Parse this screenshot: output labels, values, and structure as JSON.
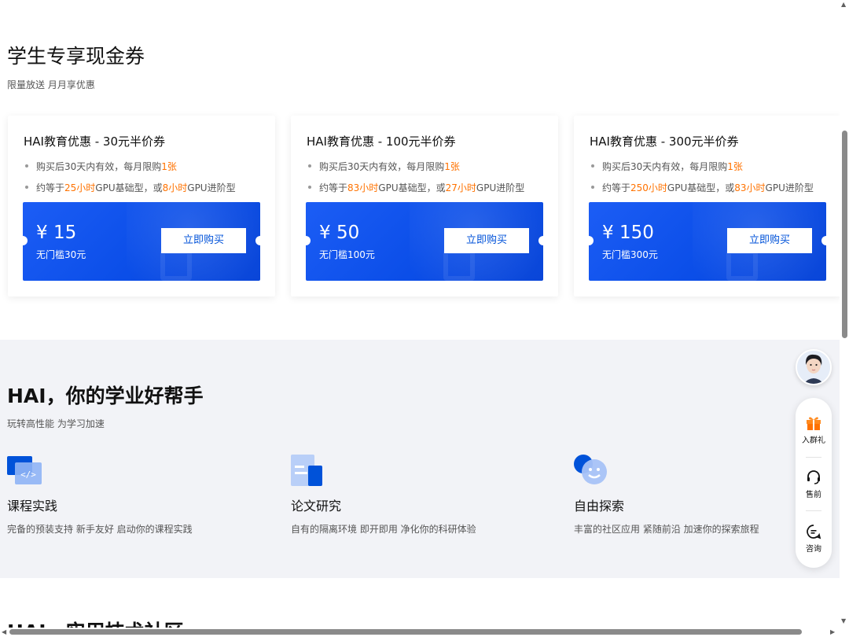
{
  "section1": {
    "title": "学生专享现金券",
    "subtitle": "限量放送  月月享优惠",
    "cards": [
      {
        "title": "HAI教育优惠 - 30元半价券",
        "line1_pre": "购买后30天内有效，每月限购",
        "line1_hl": "1张",
        "line2_a": "约等于",
        "line2_b": "25小时",
        "line2_c": "GPU基础型，或",
        "line2_d": "8小时",
        "line2_e": "GPU进阶型",
        "price": "¥ 15",
        "threshold": "无门槛30元",
        "button": "立即购买"
      },
      {
        "title": "HAI教育优惠 - 100元半价券",
        "line1_pre": "购买后30天内有效，每月限购",
        "line1_hl": "1张",
        "line2_a": "约等于",
        "line2_b": "83小时",
        "line2_c": "GPU基础型，或",
        "line2_d": "27小时",
        "line2_e": "GPU进阶型",
        "price": "¥ 50",
        "threshold": "无门槛100元",
        "button": "立即购买"
      },
      {
        "title": "HAI教育优惠 - 300元半价券",
        "line1_pre": "购买后30天内有效，每月限购",
        "line1_hl": "1张",
        "line2_a": "约等于",
        "line2_b": "250小时",
        "line2_c": "GPU基础型，或",
        "line2_d": "83小时",
        "line2_e": "GPU进阶型",
        "price": "¥ 150",
        "threshold": "无门槛300元",
        "button": "立即购买"
      }
    ]
  },
  "section2": {
    "title": "HAI，你的学业好帮手",
    "subtitle": "玩转高性能  为学习加速",
    "features": [
      {
        "icon": "code-window-icon",
        "name": "课程实践",
        "desc": "完备的预装支持  新手友好  启动你的课程实践"
      },
      {
        "icon": "document-icon",
        "name": "论文研究",
        "desc": "自有的隔离环境  即开即用  净化你的科研体验"
      },
      {
        "icon": "smile-chat-icon",
        "name": "自由探索",
        "desc": "丰富的社区应用  紧随前沿  加速你的探索旅程"
      }
    ]
  },
  "section3": {
    "title": "HAI，实用技术社区"
  },
  "float": {
    "avatar_icon": "assistant-avatar-icon",
    "items": [
      {
        "icon": "gift-icon",
        "label": "入群礼"
      },
      {
        "icon": "headset-icon",
        "label": "售前"
      },
      {
        "icon": "chat-icon",
        "label": "咨询"
      }
    ]
  },
  "colors": {
    "accent": "#0052d9",
    "highlight": "#ff7200",
    "section_bg": "#f2f3f7"
  }
}
